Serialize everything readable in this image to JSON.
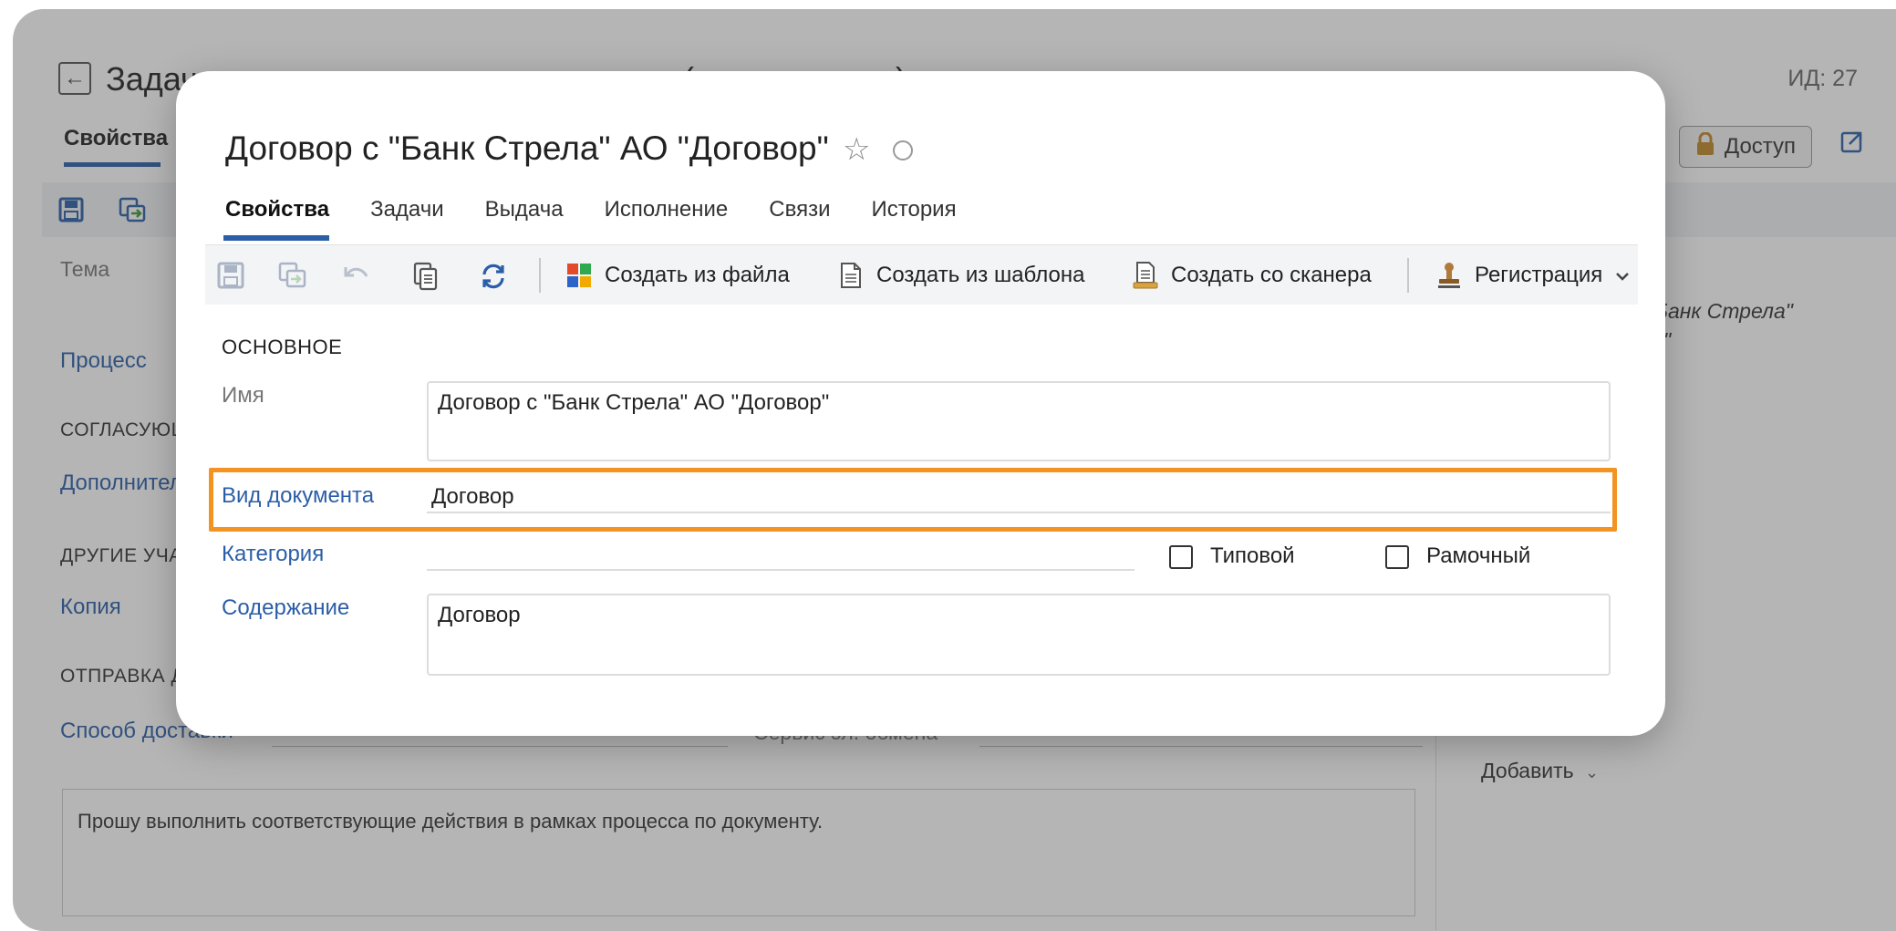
{
  "background": {
    "title": "Задача на согласование по процессу (новая запись)",
    "id_label": "ИД: 27",
    "tab_properties": "Свойства",
    "access_button": "Доступ",
    "fields": {
      "topic": "Тема",
      "process": "Процесс",
      "approving_section": "СОГЛАСУЮЩИЕ",
      "additional": "Дополнительно",
      "other_participants_section": "ДРУГИЕ УЧАСТНИКИ",
      "copy": "Копия",
      "sending_section": "ОТПРАВКА ДОКУМЕНТОВ",
      "delivery_method": "Способ доставки",
      "email_service": "Сервис эл. обмена"
    },
    "right_panel": {
      "doc_text_line1": "Банк Стрела\"",
      "doc_text_line2": "\"",
      "add_button": "Добавить"
    },
    "message_text": "Прошу выполнить соответствующие действия в рамках процесса по документу."
  },
  "modal": {
    "title": "Договор с \"Банк Стрела\" АО \"Договор\"",
    "tabs": [
      {
        "label": "Свойства",
        "active": true
      },
      {
        "label": "Задачи",
        "active": false
      },
      {
        "label": "Выдача",
        "active": false
      },
      {
        "label": "Исполнение",
        "active": false
      },
      {
        "label": "Связи",
        "active": false
      },
      {
        "label": "История",
        "active": false
      }
    ],
    "toolbar": {
      "create_from_file": "Создать из файла",
      "create_from_template": "Создать из шаблона",
      "create_from_scanner": "Создать со сканера",
      "registration": "Регистрация"
    },
    "section_main": "ОСНОВНОЕ",
    "fields": {
      "name_label": "Имя",
      "name_value": "Договор с \"Банк Стрела\" АО \"Договор\"",
      "doc_type_label": "Вид документа",
      "doc_type_value": "Договор",
      "category_label": "Категория",
      "category_value": "",
      "typical_label": "Типовой",
      "typical_checked": false,
      "frame_label": "Рамочный",
      "frame_checked": false,
      "content_label": "Содержание",
      "content_value": "Договор"
    }
  },
  "colors": {
    "accent_blue": "#2b5ea7",
    "highlight_orange": "#f39321"
  }
}
